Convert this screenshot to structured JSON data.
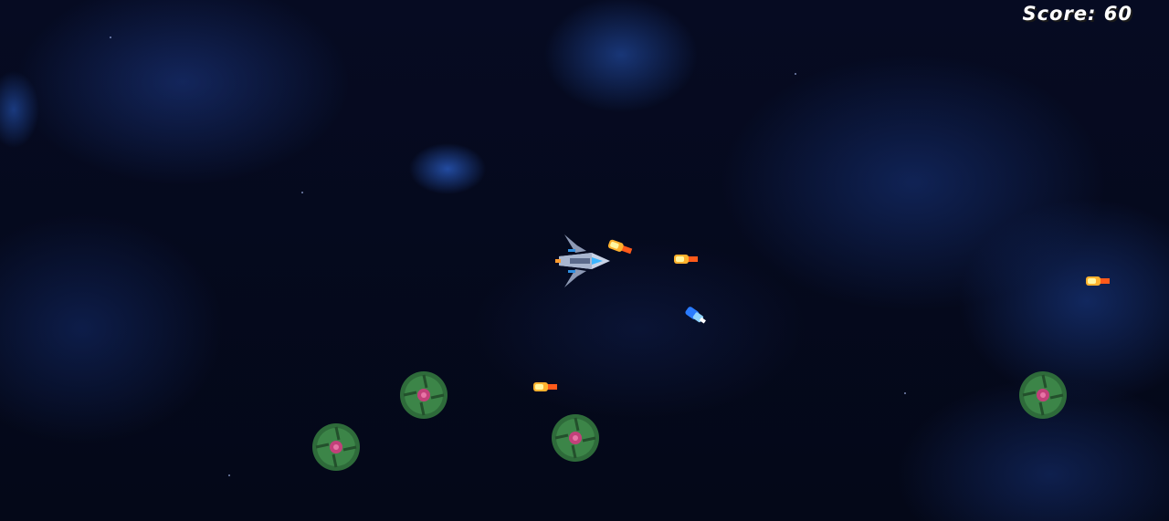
{
  "hud": {
    "score_text": "Score: 60"
  },
  "colors": {
    "space": "#05091c",
    "nebula": "#2a5bd0",
    "bullet_core": "#fff6a0",
    "bullet_flame": "#ff6a1a",
    "blue_shot": "#3aa0ff",
    "enemy_body": "#2e6b3a",
    "enemy_core": "#c2407a"
  },
  "icons": {
    "player": "player-spaceship-icon",
    "bullet": "fire-bullet-icon",
    "enemy_shot": "blue-plasma-icon",
    "enemy": "green-mine-icon"
  }
}
